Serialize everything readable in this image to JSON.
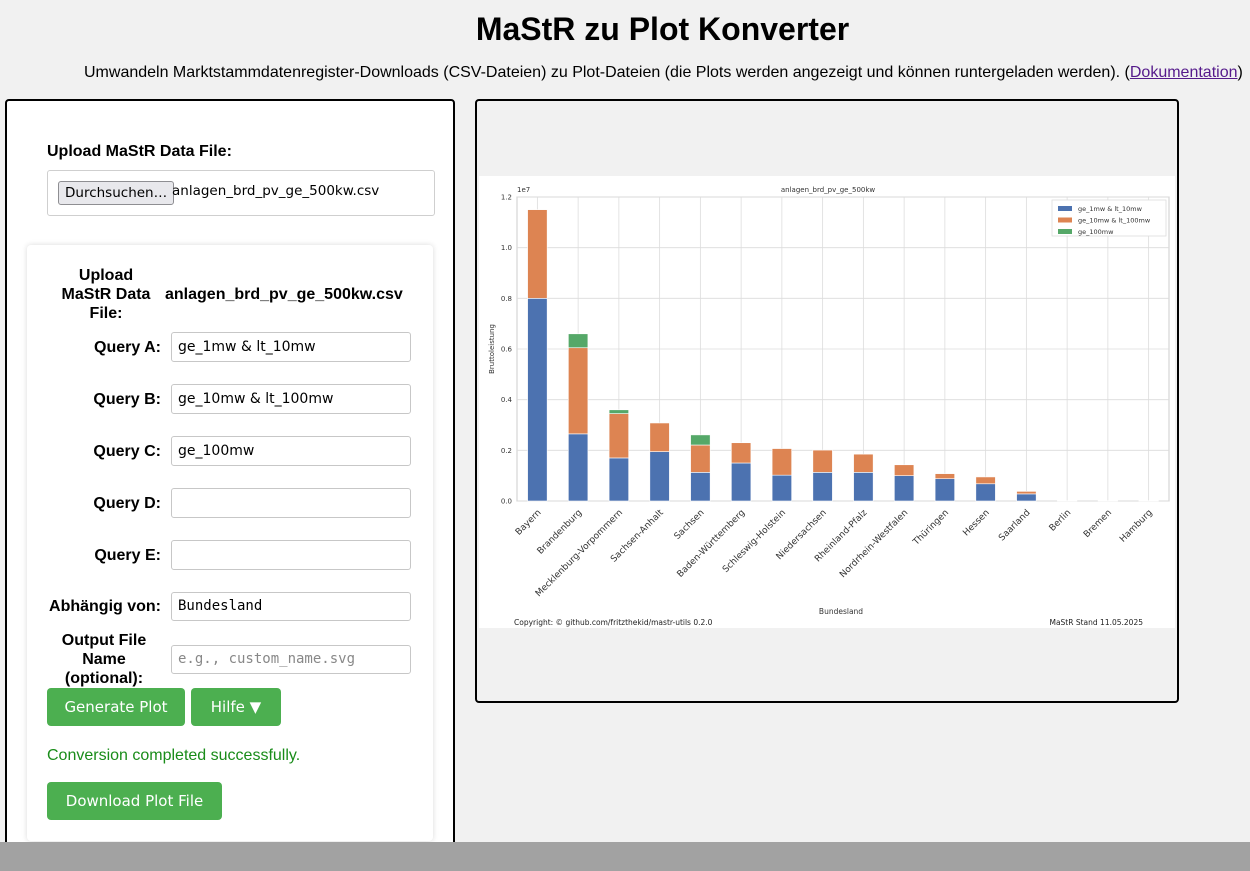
{
  "header": {
    "title": "MaStR zu Plot Konverter",
    "subtitle_prefix": "Umwandeln Marktstammdatenregister-Downloads (CSV-Dateien) zu Plot-Dateien (die Plots werden angezeigt und können runtergeladen werden). (",
    "subtitle_link": "Dokumentation",
    "subtitle_suffix": ")"
  },
  "upload": {
    "label": "Upload MaStR Data File:",
    "button": "Durchsuchen…",
    "filename": "anlagen_brd_pv_ge_500kw.csv"
  },
  "form": {
    "file_label_lines": [
      "Upload",
      "MaStR Data",
      "File:"
    ],
    "file_value": "anlagen_brd_pv_ge_500kw.csv",
    "query_a_label": "Query A:",
    "query_a_value": "ge_1mw & lt_10mw",
    "query_b_label": "Query B:",
    "query_b_value": "ge_10mw & lt_100mw",
    "query_c_label": "Query C:",
    "query_c_value": "ge_100mw",
    "query_d_label": "Query D:",
    "query_d_value": "",
    "query_e_label": "Query E:",
    "query_e_value": "",
    "depends_label": "Abhängig von:",
    "depends_value": "Bundesland",
    "output_label_lines": [
      "Output File",
      "Name",
      "(optional):"
    ],
    "output_placeholder": "e.g., custom_name.svg",
    "generate_button": "Generate Plot",
    "help_button": "Hilfe ▼",
    "status_text": "Conversion completed successfully.",
    "download_button": "Download Plot File"
  },
  "colors": {
    "button_green": "#4caf50",
    "status_green": "#198c19",
    "link": "#551a8b",
    "series": [
      "#4c72b0",
      "#dd8452",
      "#55a868"
    ]
  },
  "chart_data": {
    "type": "bar",
    "stacked": true,
    "title": "anlagen_brd_pv_ge_500kw",
    "xlabel": "Bundesland",
    "ylabel": "Bruttoleistung",
    "y_offset_label": "1e7",
    "ylim": [
      0,
      1.2
    ],
    "yticks": [
      "0.0",
      "0.2",
      "0.4",
      "0.6",
      "0.8",
      "1.0",
      "1.2"
    ],
    "grid": true,
    "legend_position": "top-right",
    "categories": [
      "Bayern",
      "Brandenburg",
      "Mecklenburg-Vorpommern",
      "Sachsen-Anhalt",
      "Sachsen",
      "Baden-Württemberg",
      "Schleswig-Holstein",
      "Niedersachsen",
      "Rheinland-Pfalz",
      "Nordrhein-Westfalen",
      "Thüringen",
      "Hessen",
      "Saarland",
      "Berlin",
      "Bremen",
      "Hamburg"
    ],
    "series": [
      {
        "name": "ge_1mw & lt_10mw",
        "values": [
          0.8,
          0.265,
          0.17,
          0.195,
          0.113,
          0.15,
          0.102,
          0.113,
          0.113,
          0.1,
          0.088,
          0.068,
          0.028,
          0.001,
          0.001,
          0.001
        ]
      },
      {
        "name": "ge_10mw & lt_100mw",
        "values": [
          0.35,
          0.34,
          0.175,
          0.113,
          0.108,
          0.08,
          0.105,
          0.088,
          0.072,
          0.043,
          0.02,
          0.027,
          0.01,
          0,
          0,
          0
        ]
      },
      {
        "name": "ge_100mw",
        "values": [
          0,
          0.055,
          0.015,
          0,
          0.04,
          0,
          0,
          0,
          0,
          0,
          0,
          0,
          0,
          0,
          0,
          0
        ]
      }
    ],
    "footer_left": "Copyright: © github.com/fritzthekid/mastr-utils 0.2.0",
    "footer_right": "MaStR Stand 11.05.2025"
  }
}
